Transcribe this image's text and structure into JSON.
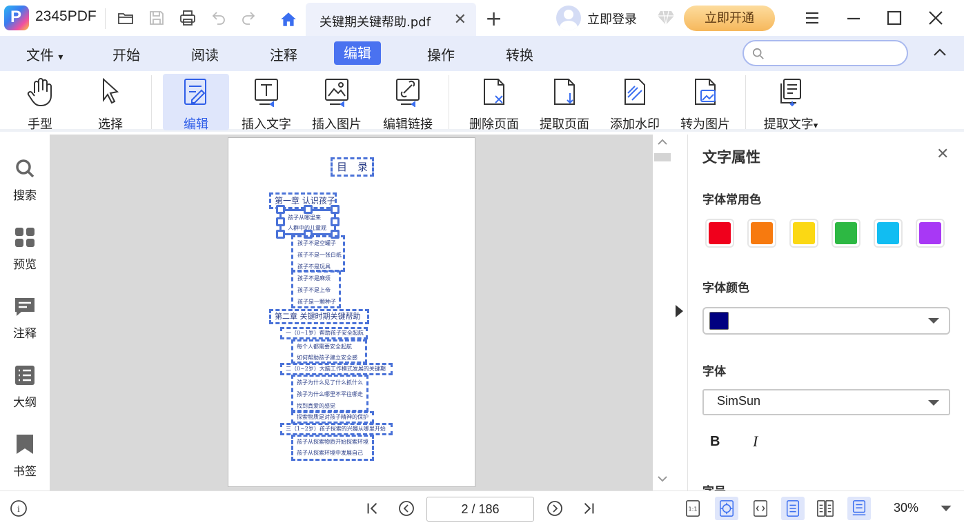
{
  "app": {
    "name": "2345PDF",
    "logo_letter": "P"
  },
  "tabs": {
    "document_name": "关键期关键帮助.pdf",
    "close": "✕",
    "new": "+"
  },
  "account": {
    "login_label": "立即登录",
    "vip_label": "立即开通"
  },
  "menu": [
    {
      "label": "文件",
      "caret": "▾"
    },
    {
      "label": "开始"
    },
    {
      "label": "阅读"
    },
    {
      "label": "注释"
    },
    {
      "label": "编辑",
      "active": true
    },
    {
      "label": "操作"
    },
    {
      "label": "转换"
    }
  ],
  "search": {
    "placeholder": "",
    "value": ""
  },
  "ribbon": [
    {
      "label": "手型",
      "icon": "hand-icon"
    },
    {
      "label": "选择",
      "icon": "cursor-icon"
    },
    {
      "label": "编辑",
      "icon": "edit-doc-icon",
      "active": true
    },
    {
      "label": "插入文字",
      "icon": "insert-text-icon"
    },
    {
      "label": "插入图片",
      "icon": "insert-image-icon"
    },
    {
      "label": "编辑链接",
      "icon": "edit-link-icon"
    },
    {
      "label": "删除页面",
      "icon": "delete-page-icon"
    },
    {
      "label": "提取页面",
      "icon": "extract-page-icon"
    },
    {
      "label": "添加水印",
      "icon": "watermark-icon"
    },
    {
      "label": "转为图片",
      "icon": "to-image-icon"
    },
    {
      "label": "提取文字",
      "icon": "extract-text-icon",
      "caret": "▾"
    }
  ],
  "sidebar": [
    {
      "label": "搜索",
      "icon": "search-icon"
    },
    {
      "label": "预览",
      "icon": "grid-icon"
    },
    {
      "label": "注释",
      "icon": "comment-icon"
    },
    {
      "label": "大纲",
      "icon": "outline-icon"
    },
    {
      "label": "书签",
      "icon": "bookmark-icon"
    }
  ],
  "document": {
    "toc_title": "目　录",
    "chapter1": "第一章 认识孩子",
    "c1_lines_a": [
      "孩子从哪里来",
      "人群中的儿童观"
    ],
    "c1_lines_b": [
      "孩子不是空罐子",
      "孩子不是一张白纸",
      "孩子不是玩具"
    ],
    "c1_lines_c": [
      "孩子不是麻烦",
      "孩子不是上帝",
      "孩子是一颗种子"
    ],
    "chapter2": "第二章 关键时期关键帮助",
    "s1": "一（0~1岁）帮助孩子安全起航",
    "s1_lines": [
      "每个人都需要安全起航",
      "如何帮助孩子建立安全感"
    ],
    "s2": "二（0~2岁）大脑工作模式发展的关键期",
    "s2_lines": [
      "孩子为什么见了什么抓什么",
      "孩子为什么哪里不平往哪走",
      "找到真爱的感觉"
    ],
    "s2_extra": "探索物质是对孩子精神的保护",
    "s3": "三（1~2岁）孩子探索的兴趣从哪里开始",
    "s3_lines": [
      "孩子从探索物质开始探索环境",
      "孩子从探索环境中发展自己"
    ]
  },
  "panel": {
    "title": "文字属性",
    "close": "✕",
    "common_colors_label": "字体常用色",
    "common_colors": [
      "#f0001c",
      "#f77a0f",
      "#fbd814",
      "#2db843",
      "#11bdf2",
      "#a838f5"
    ],
    "font_color_label": "字体颜色",
    "font_color": "#000080",
    "font_label": "字体",
    "font_value": "SimSun",
    "bold_label": "B",
    "italic_label": "I",
    "size_label": "字号"
  },
  "status": {
    "info": "i",
    "page_indicator": "2 / 186",
    "zoom": "30%"
  }
}
